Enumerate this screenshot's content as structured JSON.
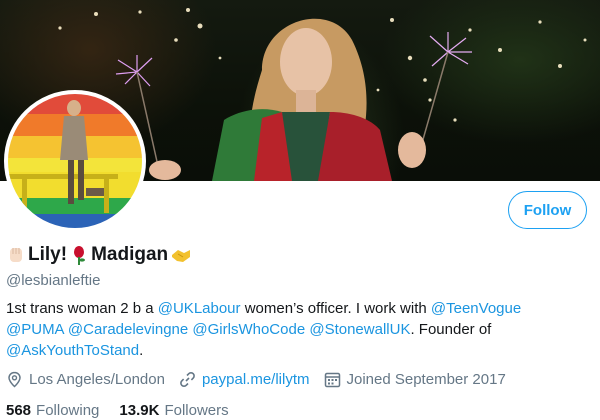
{
  "profile": {
    "name_part1": "Lily!",
    "name_part2": "Madigan",
    "handle": "@lesbianleftie",
    "follow_label": "Follow",
    "bio": {
      "t1": "1st trans woman 2 b a ",
      "m1": "@UKLabour",
      "t2": " women’s officer. I work with ",
      "m2": "@TeenVogue",
      "m3": "@PUMA",
      "m4": "@Caradelevingne",
      "m5": "@GirlsWhoCode",
      "m6": "@StonewallUK",
      "t3": ". Founder of",
      "m7": "@AskYouthToStand",
      "t4": "."
    },
    "location": "Los Angeles/London",
    "website": "paypal.me/lilytm",
    "joined": "Joined September 2017",
    "following_count": "568",
    "following_label": "Following",
    "followers_count": "13.9K",
    "followers_label": "Followers"
  },
  "icons": {
    "name_emoji_1": "raised-fist-emoji",
    "name_emoji_2": "rose-emoji",
    "name_emoji_3": "handshake-emoji",
    "location": "location-pin-icon",
    "website": "link-icon",
    "joined": "calendar-icon"
  },
  "colors": {
    "accent": "#1da1f2",
    "link": "#1b95e0",
    "secondary_text": "#657786",
    "primary_text": "#14171a"
  }
}
